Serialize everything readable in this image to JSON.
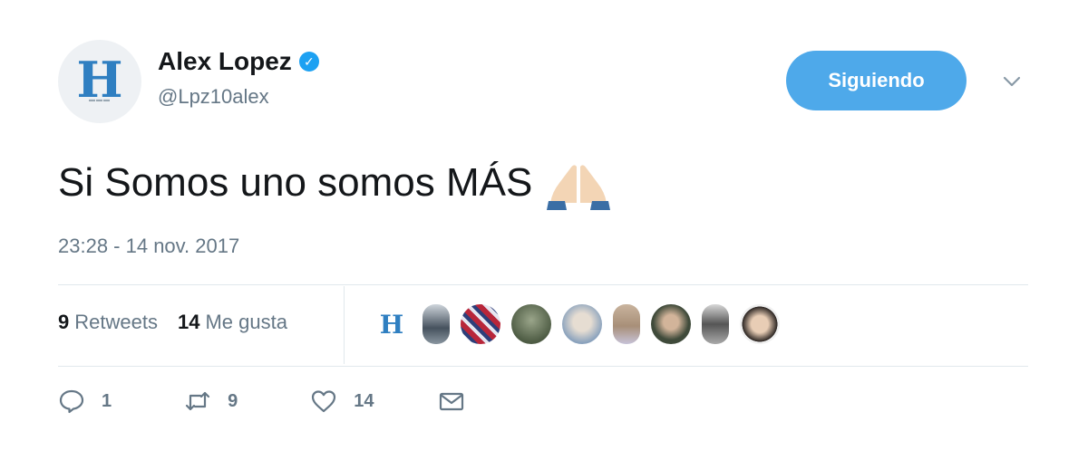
{
  "author": {
    "avatar_letter": "H",
    "display_name": "Alex Lopez",
    "handle": "@Lpz10alex",
    "verified_icon": "verified-badge-icon"
  },
  "follow_button": {
    "label": "Siguiendo"
  },
  "menu_icon": "chevron-down-icon",
  "tweet": {
    "text": "Si Somos uno somos MÁS",
    "emoji": "folded-hands-icon",
    "timestamp": "23:28 - 14 nov. 2017"
  },
  "stats": {
    "retweets_count": "9",
    "retweets_label": "Retweets",
    "likes_count": "14",
    "likes_label": "Me gusta"
  },
  "likers": [
    {
      "label": "H"
    }
  ],
  "actions": {
    "reply_count": "1",
    "retweet_count": "9",
    "like_count": "14"
  },
  "colors": {
    "accent": "#4ea9ea",
    "verified": "#1da1f2",
    "secondary_text": "#657786",
    "divider": "#e1e8ed"
  }
}
